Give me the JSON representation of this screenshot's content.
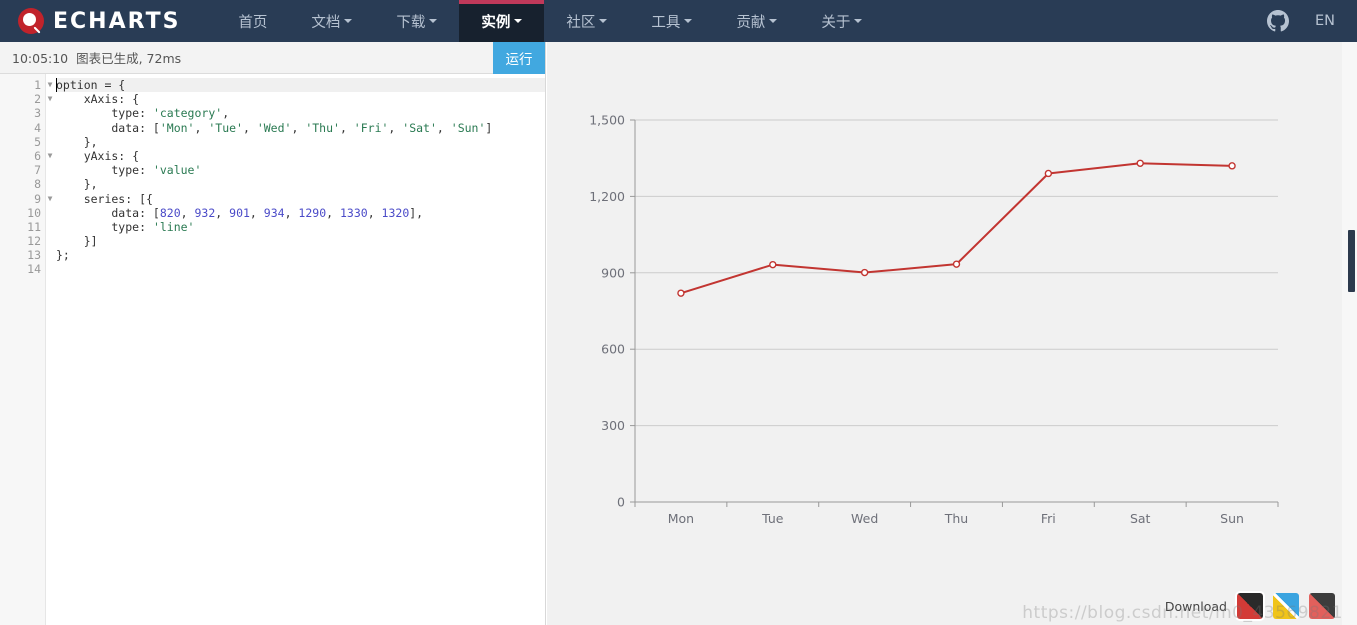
{
  "navbar": {
    "brand": "ECHARTS",
    "brand_icon": "echarts-logo-icon",
    "items": [
      {
        "label": "首页",
        "has_caret": false,
        "active": false
      },
      {
        "label": "文档",
        "has_caret": true,
        "active": false
      },
      {
        "label": "下载",
        "has_caret": true,
        "active": false
      },
      {
        "label": "实例",
        "has_caret": true,
        "active": true
      },
      {
        "label": "社区",
        "has_caret": true,
        "active": false
      },
      {
        "label": "工具",
        "has_caret": true,
        "active": false
      },
      {
        "label": "贡献",
        "has_caret": true,
        "active": false
      },
      {
        "label": "关于",
        "has_caret": true,
        "active": false
      }
    ],
    "github_icon": "github-icon",
    "language": "EN",
    "bg_color": "#293c55",
    "active_bg_color": "#17212e",
    "active_top_accent": "#c0395a"
  },
  "editor": {
    "status_time": "10:05:10",
    "status_message": "图表已生成, 72ms",
    "run_label": "运行",
    "run_color": "#41a8e0",
    "line_numbers": [
      1,
      2,
      3,
      4,
      5,
      6,
      7,
      8,
      9,
      10,
      11,
      12,
      13,
      14
    ],
    "fold_lines": [
      1,
      2,
      6,
      9
    ],
    "active_line": 1,
    "code_lines": [
      {
        "n": 1,
        "segments": [
          {
            "t": "option = {",
            "k": "plain"
          }
        ]
      },
      {
        "n": 2,
        "segments": [
          {
            "t": "    xAxis: {",
            "k": "plain"
          }
        ]
      },
      {
        "n": 3,
        "segments": [
          {
            "t": "        type: ",
            "k": "plain"
          },
          {
            "t": "'category'",
            "k": "str"
          },
          {
            "t": ",",
            "k": "plain"
          }
        ]
      },
      {
        "n": 4,
        "segments": [
          {
            "t": "        data: [",
            "k": "plain"
          },
          {
            "t": "'Mon'",
            "k": "str"
          },
          {
            "t": ", ",
            "k": "plain"
          },
          {
            "t": "'Tue'",
            "k": "str"
          },
          {
            "t": ", ",
            "k": "plain"
          },
          {
            "t": "'Wed'",
            "k": "str"
          },
          {
            "t": ", ",
            "k": "plain"
          },
          {
            "t": "'Thu'",
            "k": "str"
          },
          {
            "t": ", ",
            "k": "plain"
          },
          {
            "t": "'Fri'",
            "k": "str"
          },
          {
            "t": ", ",
            "k": "plain"
          },
          {
            "t": "'Sat'",
            "k": "str"
          },
          {
            "t": ", ",
            "k": "plain"
          },
          {
            "t": "'Sun'",
            "k": "str"
          },
          {
            "t": "]",
            "k": "plain"
          }
        ]
      },
      {
        "n": 5,
        "segments": [
          {
            "t": "    },",
            "k": "plain"
          }
        ]
      },
      {
        "n": 6,
        "segments": [
          {
            "t": "    yAxis: {",
            "k": "plain"
          }
        ]
      },
      {
        "n": 7,
        "segments": [
          {
            "t": "        type: ",
            "k": "plain"
          },
          {
            "t": "'value'",
            "k": "str"
          }
        ]
      },
      {
        "n": 8,
        "segments": [
          {
            "t": "    },",
            "k": "plain"
          }
        ]
      },
      {
        "n": 9,
        "segments": [
          {
            "t": "    series: [{",
            "k": "plain"
          }
        ]
      },
      {
        "n": 10,
        "segments": [
          {
            "t": "        data: [",
            "k": "plain"
          },
          {
            "t": "820",
            "k": "num"
          },
          {
            "t": ", ",
            "k": "plain"
          },
          {
            "t": "932",
            "k": "num"
          },
          {
            "t": ", ",
            "k": "plain"
          },
          {
            "t": "901",
            "k": "num"
          },
          {
            "t": ", ",
            "k": "plain"
          },
          {
            "t": "934",
            "k": "num"
          },
          {
            "t": ", ",
            "k": "plain"
          },
          {
            "t": "1290",
            "k": "num"
          },
          {
            "t": ", ",
            "k": "plain"
          },
          {
            "t": "1330",
            "k": "num"
          },
          {
            "t": ", ",
            "k": "plain"
          },
          {
            "t": "1320",
            "k": "num"
          },
          {
            "t": "],",
            "k": "plain"
          }
        ]
      },
      {
        "n": 11,
        "segments": [
          {
            "t": "        type: ",
            "k": "plain"
          },
          {
            "t": "'line'",
            "k": "str"
          }
        ]
      },
      {
        "n": 12,
        "segments": [
          {
            "t": "    }]",
            "k": "plain"
          }
        ]
      },
      {
        "n": 13,
        "segments": [
          {
            "t": "};",
            "k": "plain"
          }
        ]
      },
      {
        "n": 14,
        "segments": [
          {
            "t": "",
            "k": "plain"
          }
        ]
      }
    ]
  },
  "chart_data": {
    "type": "line",
    "title": "",
    "xlabel": "",
    "ylabel": "",
    "categories": [
      "Mon",
      "Tue",
      "Wed",
      "Thu",
      "Fri",
      "Sat",
      "Sun"
    ],
    "values": [
      820,
      932,
      901,
      934,
      1290,
      1330,
      1320
    ],
    "series": [
      {
        "name": "",
        "values": [
          820,
          932,
          901,
          934,
          1290,
          1330,
          1320
        ]
      }
    ],
    "ylim": [
      0,
      1500
    ],
    "ytick_labels": [
      "0",
      "300",
      "600",
      "900",
      "1,200",
      "1,500"
    ],
    "ytick_values": [
      0,
      300,
      600,
      900,
      1200,
      1500
    ],
    "grid": true,
    "legend": "none",
    "line_color": "#c23531",
    "symbol": "circle",
    "background": "#f1f1f1"
  },
  "download": {
    "label": "Download",
    "themes": [
      {
        "name": "theme-swatch-default",
        "selected": true
      },
      {
        "name": "theme-swatch-light",
        "selected": false
      },
      {
        "name": "theme-swatch-dark",
        "selected": false
      }
    ]
  },
  "watermark": "https://blog.csdn.net/m0_43569821"
}
